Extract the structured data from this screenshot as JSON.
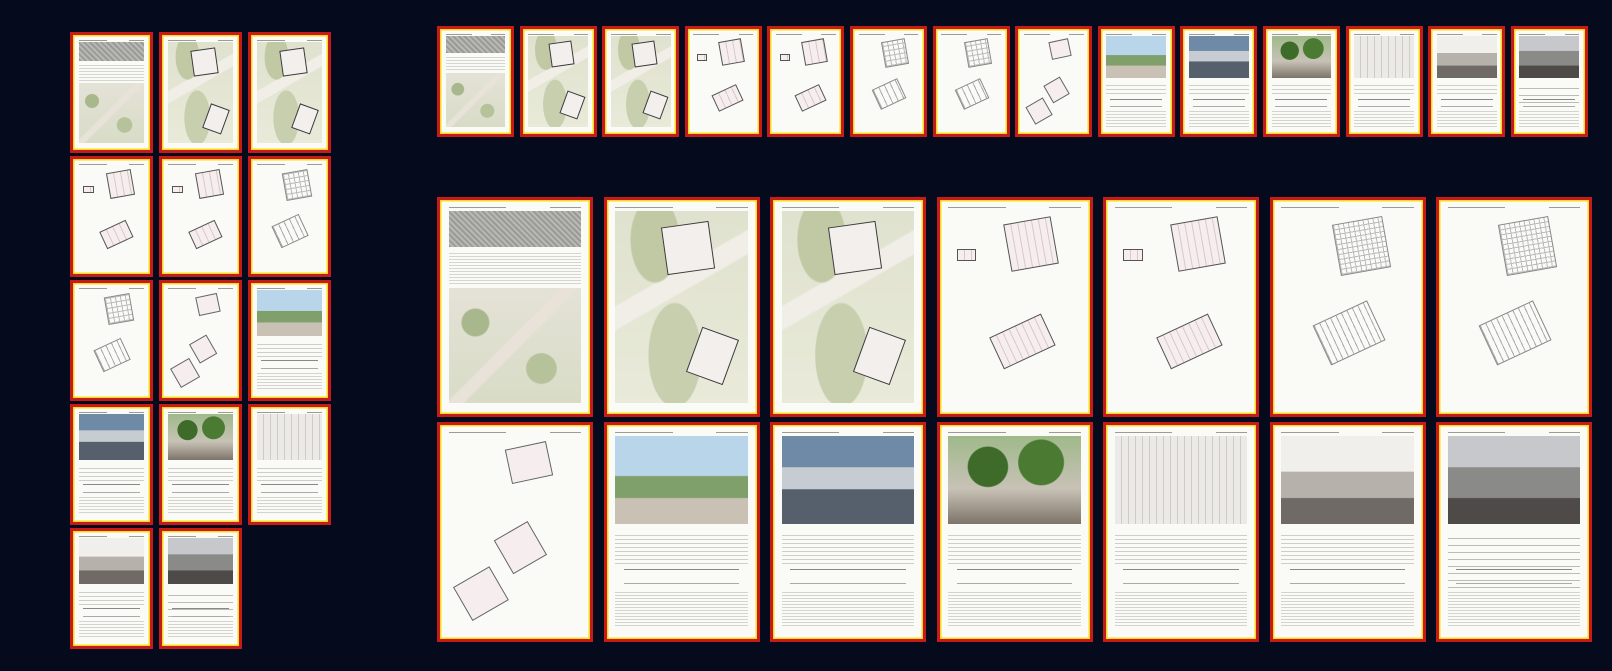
{
  "colors": {
    "background": "#050a1c",
    "frame_border": "#c71a1a",
    "frame_inner": "#f2dc1b",
    "sheet": "#fbfbf7"
  },
  "groups": [
    {
      "id": "thumbnail-grid",
      "columns": 3,
      "pages": [
        "aerial",
        "site",
        "site",
        "plan",
        "plan",
        "sect",
        "sect",
        "small",
        "render-sky",
        "render-plaza",
        "render-trees",
        "render-atrium",
        "render-hall",
        "render-crowd"
      ]
    },
    {
      "id": "filmstrip-row",
      "columns": 14,
      "pages": [
        "aerial",
        "site",
        "site",
        "plan",
        "plan",
        "sect",
        "sect",
        "small",
        "render-sky",
        "render-plaza",
        "render-trees",
        "render-atrium",
        "render-hall",
        "render-crowd"
      ]
    },
    {
      "id": "large-grid",
      "columns": 7,
      "pages": [
        "aerial",
        "site",
        "site",
        "plan",
        "plan",
        "sect",
        "sect",
        "small",
        "render-sky",
        "render-plaza",
        "render-trees",
        "render-atrium",
        "render-hall",
        "render-crowd"
      ]
    }
  ]
}
